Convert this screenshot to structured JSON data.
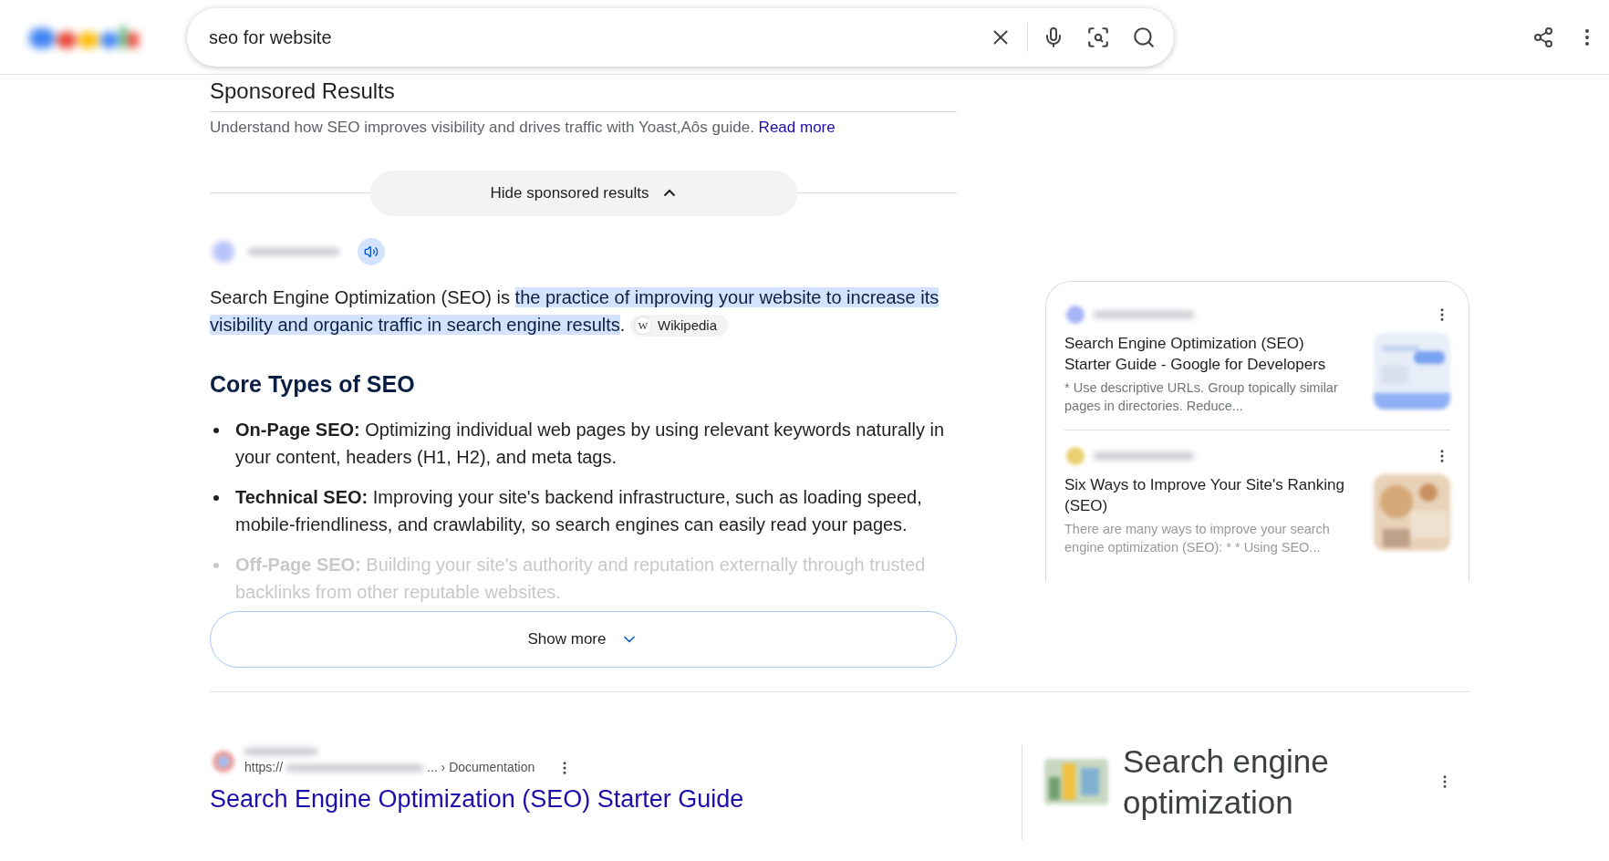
{
  "search": {
    "value": "seo for website"
  },
  "sponsored": {
    "title": "Sponsored Results",
    "text": "Understand how SEO improves visibility and drives traffic with Yoast,Aôs guide.",
    "link": "Read more",
    "hide_button": "Hide sponsored results"
  },
  "overview": {
    "intro": "Search Engine Optimization (SEO) is ",
    "highlight": "the practice of improving your website to increase its visibility and organic traffic in search engine results",
    "after": ".",
    "source_chip": "Wikipedia",
    "source_chip_icon": "W",
    "heading": "Core Types of SEO",
    "items": [
      {
        "term": "On-Page SEO:",
        "text": "Optimizing individual web pages by using relevant keywords naturally in your content, headers (H1, H2), and meta tags.",
        "faded": false
      },
      {
        "term": "Technical SEO:",
        "text": "Improving your site's backend infrastructure, such as loading speed, mobile-friendliness, and crawlability, so search engines can easily read your pages.",
        "faded": false
      },
      {
        "term": "Off-Page SEO:",
        "text": "Building your site's authority and reputation externally through trusted backlinks from other reputable websites.",
        "faded": true
      }
    ],
    "show_more": "Show more"
  },
  "side_card": {
    "results": [
      {
        "title": "Search Engine Optimization (SEO) Starter Guide - Google for Developers",
        "snippet": "* Use descriptive URLs. Group topically similar pages in directories. Reduce...",
        "color": "#a8b4f8"
      },
      {
        "title": "Six Ways to Improve Your Site's Ranking (SEO)",
        "snippet": "There are many ways to improve your search engine optimization (SEO): * * Using SEO...",
        "color": "#e8d070"
      }
    ]
  },
  "result": {
    "url_prefix": "https://",
    "url_suffix": "... › Documentation",
    "title": "Search Engine Optimization (SEO) Starter Guide"
  },
  "knowledge_panel": {
    "title": "Search engine optimization"
  }
}
